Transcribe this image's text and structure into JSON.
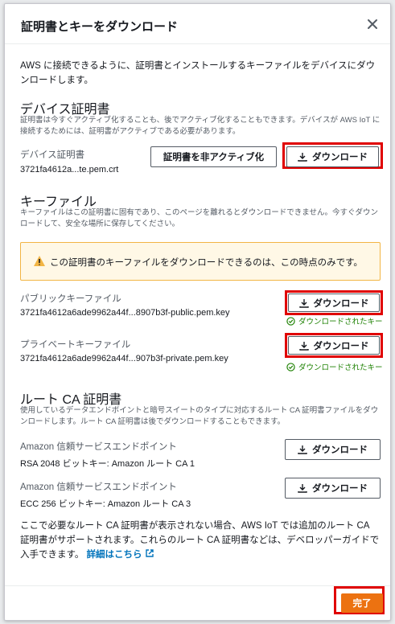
{
  "modal": {
    "title": "証明書とキーをダウンロード",
    "intro": "AWS に接続できるように、証明書とインストールするキーファイルをデバイスにダウンロードします。"
  },
  "device_cert": {
    "heading": "デバイス証明書",
    "description": "証明書は今すぐアクティブ化することも、後でアクティブ化することもできます。デバイスが AWS IoT に接続するためには、証明書がアクティブである必要があります。",
    "label": "デバイス証明書",
    "filename": "3721fa4612a...te.pem.crt",
    "deactivate_label": "証明書を非アクティブ化",
    "download_label": "ダウンロード"
  },
  "key_files": {
    "heading": "キーファイル",
    "description": "キーファイルはこの証明書に固有であり、このページを離れるとダウンロードできません。今すぐダウンロードして、安全な場所に保存してください。",
    "alert": "この証明書のキーファイルをダウンロードできるのは、この時点のみです。",
    "public": {
      "label": "パブリックキーファイル",
      "filename": "3721fa4612a6ade9962a44f...8907b3f-public.pem.key",
      "download_label": "ダウンロード",
      "status": "ダウンロードされたキー"
    },
    "private": {
      "label": "プライベートキーファイル",
      "filename": "3721fa4612a6ade9962a44f...907b3f-private.pem.key",
      "download_label": "ダウンロード",
      "status": "ダウンロードされたキー"
    }
  },
  "root_ca": {
    "heading": "ルート CA 証明書",
    "description": "使用しているデータエンドポイントと暗号スイートのタイプに対応するルート CA 証明書ファイルをダウンロードします。ルート CA 証明書は後でダウンロードすることもできます。",
    "items": [
      {
        "label": "Amazon 信頼サービスエンドポイント",
        "value": "RSA 2048 ビットキー: Amazon ルート CA 1",
        "download_label": "ダウンロード"
      },
      {
        "label": "Amazon 信頼サービスエンドポイント",
        "value": "ECC 256 ビットキー: Amazon ルート CA 3",
        "download_label": "ダウンロード"
      }
    ],
    "footer_text": "ここで必要なルート CA 証明書が表示されない場合、AWS IoT では追加のルート CA 証明書がサポートされます。これらのルート CA 証明書などは、デベロッパーガイドで入手できます。",
    "link_text": "詳細はこちら"
  },
  "footer": {
    "done_label": "完了"
  },
  "colors": {
    "accent": "#ec7211",
    "success": "#1d8102",
    "warning_border": "#f2b544",
    "highlight": "#e00000",
    "link": "#0073bb"
  }
}
